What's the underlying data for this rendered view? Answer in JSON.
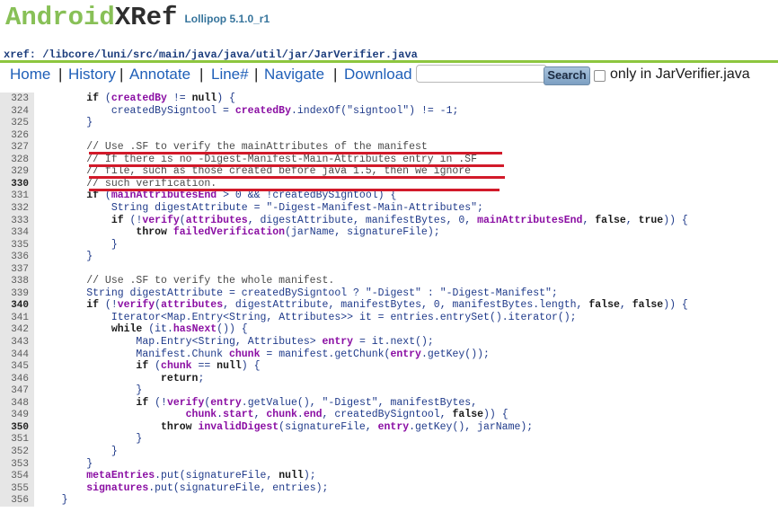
{
  "header": {
    "logo_part1": "Android",
    "logo_part2": "XRef",
    "version": "Lollipop 5.1.0_r1",
    "path_label": "xref:",
    "path": "/libcore/luni/src/main/java/java/util/jar/JarVerifier.java"
  },
  "nav": {
    "home": "Home",
    "history": "History",
    "annotate": "Annotate",
    "line": "Line#",
    "navigate": "Navigate",
    "download": "Download",
    "search_value": "",
    "search_button": "Search",
    "only_in": "only in JarVerifier.java"
  },
  "code_lines": [
    {
      "n": "323",
      "t": "        if (createdBy != null) {"
    },
    {
      "n": "324",
      "t": "            createdBySigntool = createdBy.indexOf(\"signtool\") != -1;"
    },
    {
      "n": "325",
      "t": "        }"
    },
    {
      "n": "326",
      "t": ""
    },
    {
      "n": "327",
      "t": "        // Use .SF to verify the mainAttributes of the manifest"
    },
    {
      "n": "328",
      "t": "        // If there is no -Digest-Manifest-Main-Attributes entry in .SF"
    },
    {
      "n": "329",
      "t": "        // file, such as those created before java 1.5, then we ignore"
    },
    {
      "n": "330",
      "t": "        // such verification."
    },
    {
      "n": "331",
      "t": "        if (mainAttributesEnd > 0 && !createdBySigntool) {"
    },
    {
      "n": "332",
      "t": "            String digestAttribute = \"-Digest-Manifest-Main-Attributes\";"
    },
    {
      "n": "333",
      "t": "            if (!verify(attributes, digestAttribute, manifestBytes, 0, mainAttributesEnd, false, true)) {"
    },
    {
      "n": "334",
      "t": "                throw failedVerification(jarName, signatureFile);"
    },
    {
      "n": "335",
      "t": "            }"
    },
    {
      "n": "336",
      "t": "        }"
    },
    {
      "n": "337",
      "t": ""
    },
    {
      "n": "338",
      "t": "        // Use .SF to verify the whole manifest."
    },
    {
      "n": "339",
      "t": "        String digestAttribute = createdBySigntool ? \"-Digest\" : \"-Digest-Manifest\";"
    },
    {
      "n": "340",
      "t": "        if (!verify(attributes, digestAttribute, manifestBytes, 0, manifestBytes.length, false, false)) {"
    },
    {
      "n": "341",
      "t": "            Iterator<Map.Entry<String, Attributes>> it = entries.entrySet().iterator();"
    },
    {
      "n": "342",
      "t": "            while (it.hasNext()) {"
    },
    {
      "n": "343",
      "t": "                Map.Entry<String, Attributes> entry = it.next();"
    },
    {
      "n": "344",
      "t": "                Manifest.Chunk chunk = manifest.getChunk(entry.getKey());"
    },
    {
      "n": "345",
      "t": "                if (chunk == null) {"
    },
    {
      "n": "346",
      "t": "                    return;"
    },
    {
      "n": "347",
      "t": "                }"
    },
    {
      "n": "348",
      "t": "                if (!verify(entry.getValue(), \"-Digest\", manifestBytes,"
    },
    {
      "n": "349",
      "t": "                        chunk.start, chunk.end, createdBySigntool, false)) {"
    },
    {
      "n": "350",
      "t": "                    throw invalidDigest(signatureFile, entry.getKey(), jarName);"
    },
    {
      "n": "351",
      "t": "                }"
    },
    {
      "n": "352",
      "t": "            }"
    },
    {
      "n": "353",
      "t": "        }"
    },
    {
      "n": "354",
      "t": "        metaEntries.put(signatureFile, null);"
    },
    {
      "n": "355",
      "t": "        signatures.put(signatureFile, entries);"
    },
    {
      "n": "356",
      "t": "    }"
    }
  ],
  "bold_line_numbers": [
    "330",
    "340",
    "350"
  ],
  "highlighted_lines": [
    "327",
    "328",
    "329",
    "330"
  ],
  "colors": {
    "logo_green": "#88c057",
    "accent_line": "#8dc63f",
    "link_blue": "#1f5fb8",
    "annotation_red": "#d21a2a",
    "gutter_gray": "#e6e6e6"
  }
}
